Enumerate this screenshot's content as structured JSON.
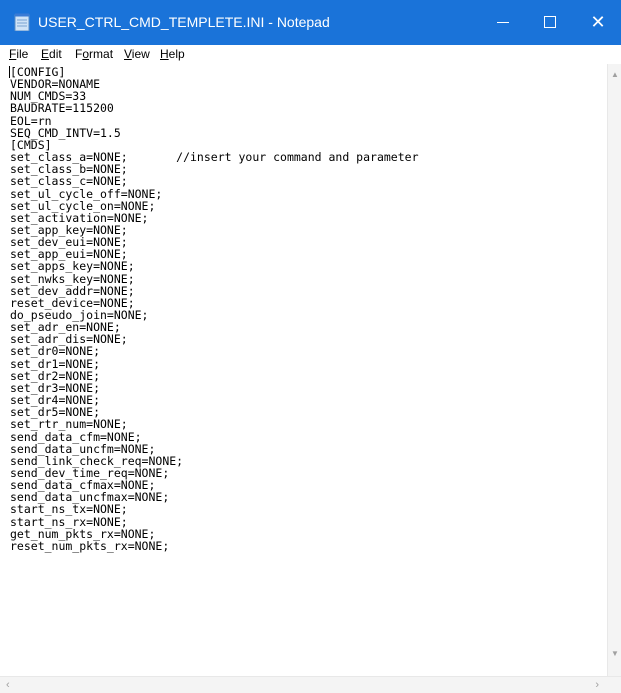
{
  "window": {
    "title": "USER_CTRL_CMD_TEMPLETE.INI - Notepad",
    "title_bar_color": "#1a73d9",
    "icons": {
      "app": "notepad-icon",
      "minimize": "minimize-icon",
      "maximize": "maximize-icon",
      "close": "close-icon"
    }
  },
  "menu": {
    "items": [
      {
        "label": "File",
        "hotkey": "F",
        "rest": "ile"
      },
      {
        "label": "Edit",
        "hotkey": "E",
        "rest": "dit"
      },
      {
        "label": "Format",
        "hotkey": "o",
        "pre": "F",
        "rest": "rmat"
      },
      {
        "label": "View",
        "hotkey": "V",
        "rest": "iew"
      },
      {
        "label": "Help",
        "hotkey": "H",
        "rest": "elp"
      }
    ]
  },
  "editor": {
    "lines": [
      "[CONFIG]",
      "VENDOR=NONAME",
      "NUM_CMDS=33",
      "BAUDRATE=115200",
      "EOL=rn",
      "SEQ_CMD_INTV=1.5",
      "[CMDS]",
      "set_class_a=NONE;       //insert your command and parameter",
      "set_class_b=NONE;",
      "set_class_c=NONE;",
      "set_ul_cycle_off=NONE;",
      "set_ul_cycle_on=NONE;",
      "set_activation=NONE;",
      "set_app_key=NONE;",
      "set_dev_eui=NONE;",
      "set_app_eui=NONE;",
      "set_apps_key=NONE;",
      "set_nwks_key=NONE;",
      "set_dev_addr=NONE;",
      "reset_device=NONE;",
      "do_pseudo_join=NONE;",
      "set_adr_en=NONE;",
      "set_adr_dis=NONE;",
      "set_dr0=NONE;",
      "set_dr1=NONE;",
      "set_dr2=NONE;",
      "set_dr3=NONE;",
      "set_dr4=NONE;",
      "set_dr5=NONE;",
      "set_rtr_num=NONE;",
      "send_data_cfm=NONE;",
      "send_data_uncfm=NONE;",
      "send_link_check_req=NONE;",
      "send_dev_time_req=NONE;",
      "send_data_cfmax=NONE;",
      "send_data_uncfmax=NONE;",
      "start_ns_tx=NONE;",
      "start_ns_rx=NONE;",
      "get_num_pkts_rx=NONE;",
      "reset_num_pkts_rx=NONE;"
    ]
  }
}
